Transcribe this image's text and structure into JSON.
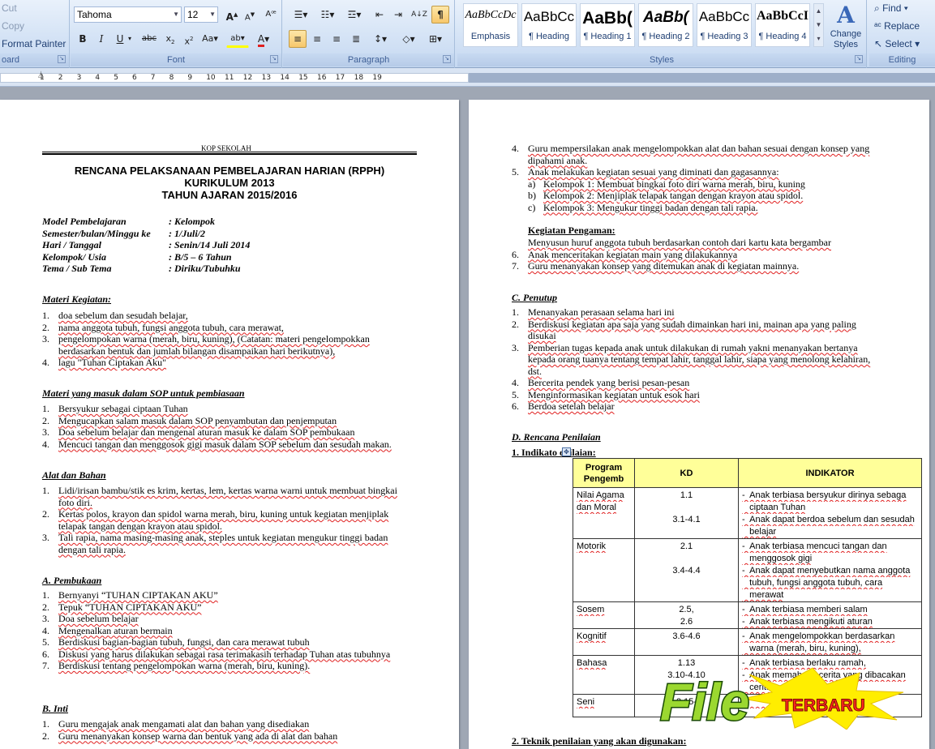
{
  "ribbon": {
    "clipboard": {
      "cut": "Cut",
      "copy": "Copy",
      "format_painter": "Format Painter",
      "label": "oard"
    },
    "font": {
      "name": "Tahoma",
      "size": "12",
      "label": "Font"
    },
    "paragraph": {
      "label": "Paragraph"
    },
    "styles": {
      "label": "Styles",
      "gallery": [
        {
          "preview": "AaBbCcDc",
          "name": "Emphasis"
        },
        {
          "preview": "AaBbCc",
          "name": "¶ Heading"
        },
        {
          "preview": "AaBb(",
          "name": "¶ Heading 1"
        },
        {
          "preview": "AaBb(",
          "name": "¶ Heading 2"
        },
        {
          "preview": "AaBbCc",
          "name": "¶ Heading 3"
        },
        {
          "preview": "AaBbCcI",
          "name": "¶ Heading 4"
        }
      ],
      "change_styles": "Change Styles"
    },
    "editing": {
      "find": "Find",
      "replace": "Replace",
      "select": "Select",
      "label": "Editing"
    }
  },
  "ruler": {
    "numbers": [
      "1",
      "2",
      "3",
      "4",
      "5",
      "6",
      "7",
      "8",
      "9",
      "10",
      "11",
      "12",
      "13",
      "14",
      "15",
      "16",
      "17",
      "18",
      "19"
    ]
  },
  "doc": {
    "kop": "KOP SEKOLAH",
    "title1": "RENCANA PELAKSANAAN PEMBELAJARAN HARIAN (RPPH)",
    "title2": "KURIKULUM 2013",
    "title3": "TAHUN AJARAN 2015/2016",
    "meta": [
      {
        "k": "Model Pembelajaran",
        "v": ": Kelompok"
      },
      {
        "k": "Semester/bulan/Minggu ke",
        "v": ": 1/Juli/2"
      },
      {
        "k": "Hari / Tanggal",
        "v": ": Senin/14 Juli 2014"
      },
      {
        "k": "Kelompok/ Usia",
        "v": ": B/5 – 6 Tahun"
      },
      {
        "k": "Tema / Sub Tema",
        "v": ": Diriku/Tubuhku"
      }
    ],
    "materi_h": "Materi Kegiatan:",
    "materi": [
      {
        "n": "1.",
        "t": "doa sebelum dan sesudah belajar,"
      },
      {
        "n": "2.",
        "t": "nama anggota tubuh, fungsi anggota tubuh, cara merawat,"
      },
      {
        "n": "3.",
        "t": "pengelompokan warna (merah, biru, kuning), (Catatan: materi pengelompokkan"
      },
      {
        "n": "",
        "t": "berdasarkan bentuk dan jumlah bilangan disampaikan hari berikutnya),"
      },
      {
        "n": "4.",
        "t": "lagu \"Tuhan Ciptakan Aku\""
      }
    ],
    "sop_h": "Materi yang masuk dalam SOP untuk pembiasaan",
    "sop": [
      {
        "n": "1.",
        "t": "Bersyukur sebagai ciptaan Tuhan"
      },
      {
        "n": "2.",
        "t": "Mengucapkan salam masuk dalam SOP penyambutan dan penjemputan"
      },
      {
        "n": "3.",
        "t": "Doa sebelum belajar dan mengenal aturan masuk ke dalam SOP pembukaan"
      },
      {
        "n": "4.",
        "t": "Mencuci tangan dan menggosok gigi masuk dalam SOP sebelum dan sesudah makan."
      }
    ],
    "alat_h": "Alat dan Bahan",
    "alat": [
      {
        "n": "1.",
        "t": "Lidi/irisan bambu/stik es krim, kertas, lem, kertas warna warni untuk membuat bingkai"
      },
      {
        "n": "",
        "t": "foto diri."
      },
      {
        "n": "2.",
        "t": "Kertas polos, krayon dan spidol warna merah, biru, kuning untuk kegiatan menjiplak"
      },
      {
        "n": "",
        "t": "telapak tangan dengan krayon atau spidol."
      },
      {
        "n": "3.",
        "t": "Tali rapia, nama masing-masing anak, steples untuk kegiatan mengukur tinggi badan"
      },
      {
        "n": "",
        "t": "dengan tali rapia."
      }
    ],
    "pembukaan_h": "A. Pembukaan",
    "pembukaan": [
      {
        "n": "1.",
        "t": "Bernyanyi “TUHAN CIPTAKAN AKU”"
      },
      {
        "n": "2.",
        "t": "Tepuk “TUHAN CIPTAKAN AKU”"
      },
      {
        "n": "3.",
        "t": "Doa sebelum belajar"
      },
      {
        "n": "4.",
        "t": "Mengenalkan aturan bermain"
      },
      {
        "n": "5.",
        "t": "Berdiskusi bagian-bagian tubuh, fungsi, dan cara merawat tubuh"
      },
      {
        "n": "6.",
        "t": "Diskusi yang harus dilakukan sebagai rasa terimakasih terhadap Tuhan atas tubuhnya"
      },
      {
        "n": "7.",
        "t": "Berdiskusi tentang pengelompokan warna (merah, biru, kuning)."
      }
    ],
    "inti_h": "B. Inti",
    "inti": [
      {
        "n": "1.",
        "t": "Guru mengajak anak mengamati alat dan bahan yang disediakan"
      },
      {
        "n": "2.",
        "t": "Guru menanyakan konsep warna dan bentuk yang ada di alat dan bahan"
      }
    ],
    "p2_list": [
      {
        "n": "4.",
        "t": "Guru mempersilakan anak mengelompokkan alat dan bahan sesuai dengan konsep yang"
      },
      {
        "n": "",
        "t": "dipahami anak."
      },
      {
        "n": "5.",
        "t": "Anak melakukan kegiatan sesuai yang diminati dan gagasannya:"
      },
      {
        "n": "a)",
        "t": "Kelompok 1: Membuat bingkai foto diri warna merah, biru, kuning"
      },
      {
        "n": "b)",
        "t": "Kelompok 2: Menjiplak telapak tangan dengan krayon atau spidol."
      },
      {
        "n": "c)",
        "t": "Kelompok 3: Mengukur tinggi badan dengan tali rapia."
      }
    ],
    "pengaman_h": "Kegiatan Pengaman:",
    "pengaman": [
      {
        "n": "",
        "t": "Menyusun huruf anggota tubuh berdasarkan contoh dari kartu kata bergambar"
      },
      {
        "n": "6.",
        "t": "Anak menceritakan kegiatan main yang dilakukannya"
      },
      {
        "n": "7.",
        "t": "Guru menanyakan konsep yang ditemukan anak di kegiatan mainnya."
      }
    ],
    "penutup_h": "C. Penutup",
    "penutup": [
      {
        "n": "1.",
        "t": "Menanyakan perasaan selama hari ini"
      },
      {
        "n": "2.",
        "t": "Berdiskusi kegiatan apa saja yang sudah dimainkan hari ini, mainan apa yang paling"
      },
      {
        "n": "",
        "t": "disukai"
      },
      {
        "n": "3.",
        "t": "Pemberian tugas kepada anak untuk dilakukan di rumah yakni menanyakan bertanya"
      },
      {
        "n": "",
        "t": "kepada orang tuanya tentang tempat lahir, tanggal lahir, siapa yang menolong kelahiran,"
      },
      {
        "n": "",
        "t": "dst."
      },
      {
        "n": "4.",
        "t": "Bercerita pendek yang berisi pesan-pesan"
      },
      {
        "n": "5.",
        "t": "Menginformasikan kegiatan untuk esok hari"
      },
      {
        "n": "6.",
        "t": "Berdoa setelah belajar"
      }
    ],
    "penilaian_h": "D. Rencana Penilaian",
    "indikator_h": "1. Indikato   enilaian:",
    "teknik_h": "2. Teknik penilaian yang akan digunakan:",
    "table": {
      "headers": [
        "Program Pengemb",
        "KD",
        "INDIKATOR"
      ],
      "rows": [
        {
          "prog": [
            "Nilai Agama",
            "dan Moral"
          ],
          "kd": [
            "1.1",
            "",
            "3.1-4.1"
          ],
          "ind": [
            "-  Anak terbiasa bersyukur dirinya sebaga",
            "   ciptaan Tuhan",
            "-  Anak dapat berdoa sebelum dan sesudah",
            "   belajar"
          ]
        },
        {
          "prog": [
            "Motorik"
          ],
          "kd": [
            "2.1",
            "",
            "3.4-4.4"
          ],
          "ind": [
            "-  Anak terbiasa mencuci tangan dan",
            "   menggosok gigi",
            "-  Anak dapat menyebutkan nama anggota",
            "   tubuh, fungsi anggota tubuh, cara",
            "   merawat"
          ]
        },
        {
          "prog": [
            "Sosem"
          ],
          "kd": [
            "2.5,",
            "2.6"
          ],
          "ind": [
            "-  Anak terbiasa memberi salam",
            "-  Anak terbiasa mengikuti aturan"
          ]
        },
        {
          "prog": [
            "Kognitif"
          ],
          "kd": [
            "3.6-4.6"
          ],
          "ind": [
            "-  Anak mengelompokkan berdasarkan",
            "   warna (merah, biru, kuning),"
          ]
        },
        {
          "prog": [
            "Bahasa"
          ],
          "kd": [
            "1.13",
            "3.10-4.10"
          ],
          "ind": [
            "-  Anak terbiasa berlaku ramah,",
            "-  Anak memahami cerita yang dibacakan",
            "   cerita"
          ]
        },
        {
          "prog": [
            "Seni"
          ],
          "kd": [
            "3.15-"
          ],
          "ind": [
            "                   kan"
          ]
        }
      ]
    }
  },
  "watermark": {
    "word1": "File",
    "word2": "TERBARU"
  }
}
